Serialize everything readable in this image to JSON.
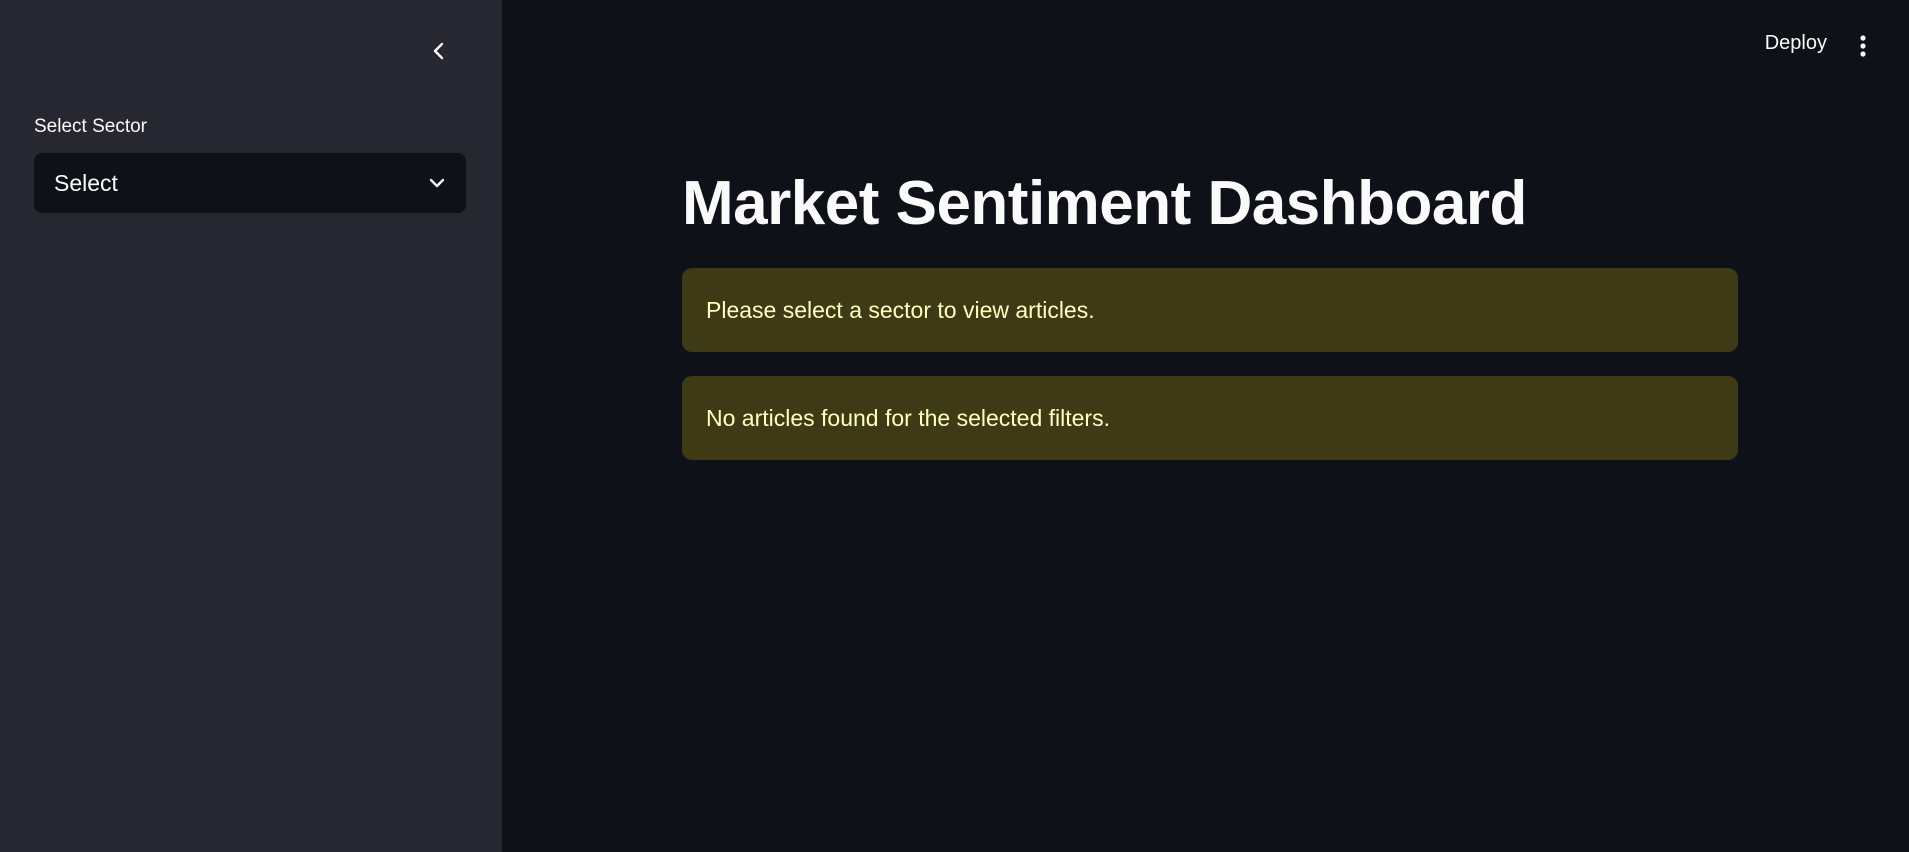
{
  "sidebar": {
    "sector_label": "Select Sector",
    "sector_select": {
      "value": "Select"
    },
    "collapse_icon": "chevron-left-icon"
  },
  "header": {
    "deploy_label": "Deploy",
    "menu_icon": "more-vertical-icon"
  },
  "main": {
    "title": "Market Sentiment Dashboard",
    "alerts": [
      {
        "text": "Please select a sector to view articles."
      },
      {
        "text": "No articles found for the selected filters."
      }
    ]
  },
  "colors": {
    "sidebar_bg": "#262730",
    "main_bg": "#0e1117",
    "warning_bg": "#3e3a16",
    "warning_text": "#ffffc2"
  }
}
